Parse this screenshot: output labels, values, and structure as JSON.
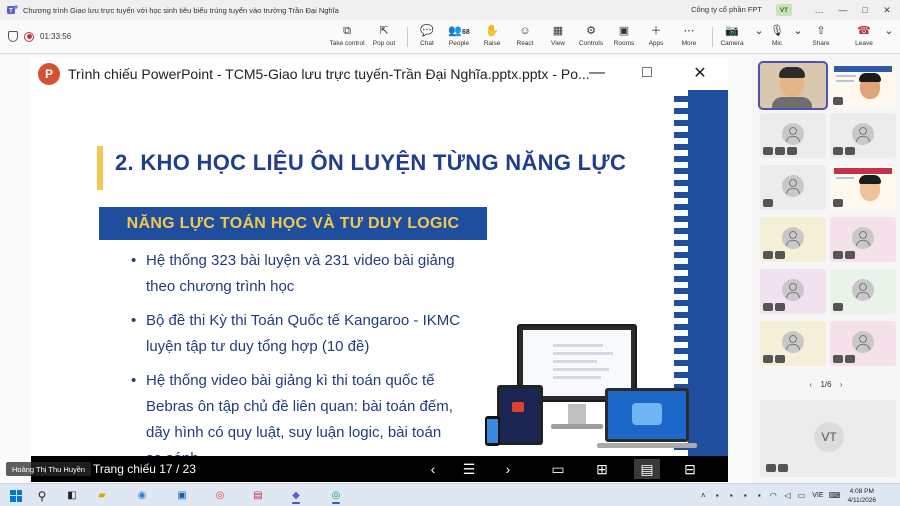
{
  "window": {
    "title": "Chương trình Giao lưu trực tuyến với học sinh tiêu biểu trúng tuyển vào trường Trần Đại Nghĩa",
    "org": "Công ty cổ phần FPT",
    "user_initials": "VT",
    "controls": [
      "—",
      "□",
      "✕",
      "…"
    ]
  },
  "toolbar": {
    "timer": "01:33:56",
    "buttons": [
      {
        "label": "Take control",
        "icon": "take-control-icon",
        "glyph": "⧉"
      },
      {
        "label": "Pop out",
        "icon": "pop-out-icon",
        "glyph": "⇱"
      },
      {
        "label": "Chat",
        "icon": "chat-icon",
        "glyph": "💬"
      },
      {
        "label": "People",
        "icon": "people-icon",
        "glyph": "👥",
        "count": "68"
      },
      {
        "label": "Raise",
        "icon": "raise-hand-icon",
        "glyph": "✋"
      },
      {
        "label": "React",
        "icon": "react-icon",
        "glyph": "☺"
      },
      {
        "label": "View",
        "icon": "view-icon",
        "glyph": "▦"
      },
      {
        "label": "Controls",
        "icon": "controls-icon",
        "glyph": "⚙"
      },
      {
        "label": "Rooms",
        "icon": "rooms-icon",
        "glyph": "▣"
      },
      {
        "label": "Apps",
        "icon": "apps-icon",
        "glyph": "＋"
      },
      {
        "label": "More",
        "icon": "more-icon",
        "glyph": "⋯"
      },
      {
        "label": "Camera",
        "icon": "camera-off-icon",
        "glyph": "📷"
      },
      {
        "label": "Mic",
        "icon": "mic-off-icon",
        "glyph": "🎙"
      },
      {
        "label": "Share",
        "icon": "share-icon",
        "glyph": "⇧"
      },
      {
        "label": "Leave",
        "icon": "leave-phone-icon",
        "glyph": "☎"
      }
    ]
  },
  "powerpoint": {
    "title": "Trình chiếu PowerPoint  -  TCM5-Giao lưu trực tuyến-Trần Đại Nghĩa.pptx.pptx - Po...",
    "logo_letter": "P",
    "controls": [
      "—",
      "□",
      "✕"
    ],
    "slide": {
      "heading": "2. KHO HỌC LIỆU ÔN LUYỆN TỪNG NĂNG LỰC",
      "subheading": "NĂNG LỰC TOÁN HỌC VÀ TƯ DUY LOGIC",
      "bullets": [
        "Hệ thống 323 bài luyện và 231 video bài giảng theo chương trình học",
        "Bộ đề thi Kỳ thi Toán Quốc tế Kangaroo - IKMC luyện tập tư duy tổng hợp (10 đề)",
        "Hệ thống video bài giảng kì thi toán quốc tế Bebras ôn tập chủ đề liên quan: bài toán đếm, dãy hình có quy luật, suy luận logic, bài toán so sánh."
      ]
    },
    "nav": {
      "counter": "Trang chiếu 17 / 23",
      "buttons": [
        "‹",
        "☰",
        "›",
        "▭",
        "⊞",
        "▤",
        "⊟"
      ]
    }
  },
  "presenter_name": "Hoàng Thị Thu Huyền",
  "participants": {
    "pager": "1/6",
    "vt_initials": "VT"
  },
  "taskbar": {
    "language": "VIE",
    "time": "4:08 PM",
    "date": "4/11/2026"
  }
}
